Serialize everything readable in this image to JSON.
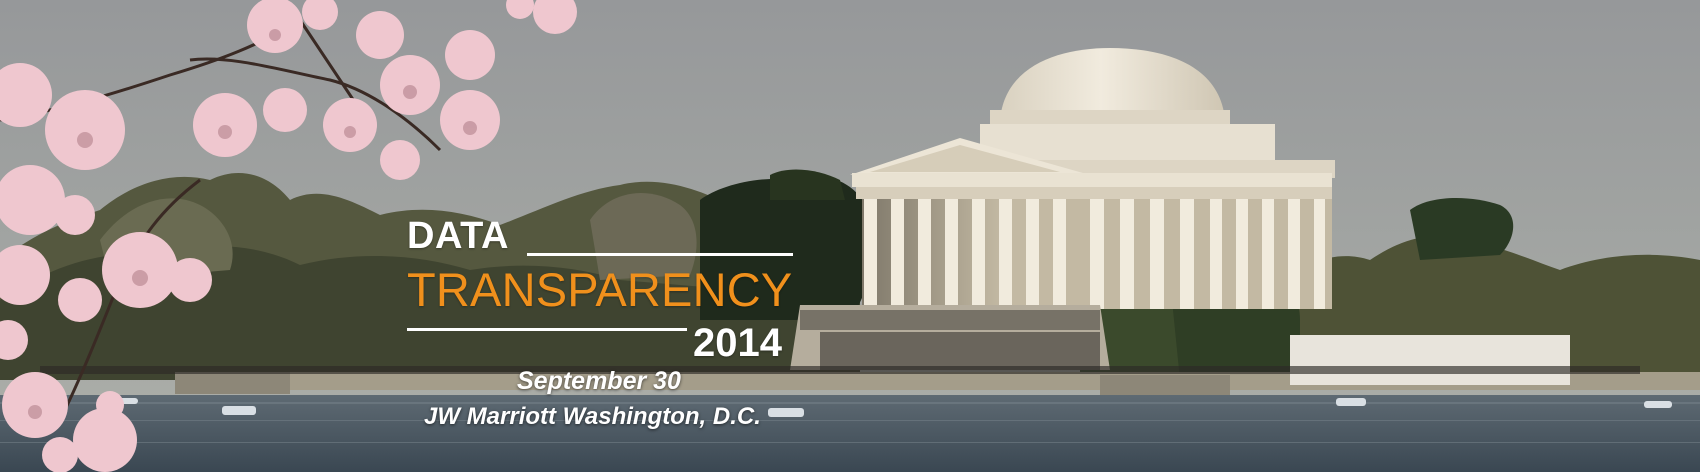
{
  "banner": {
    "title_line1": "DATA",
    "title_line2": "TRANSPARENCY",
    "year": "2014",
    "date": "September 30",
    "venue": "JW Marriott Washington, D.C."
  },
  "colors": {
    "sky": "#9fa3a0",
    "water": "#47535e",
    "memorial": "#eae3d4",
    "blossom": "#eec3cb",
    "accent_orange": "#f0901c",
    "text_white": "#ffffff"
  }
}
